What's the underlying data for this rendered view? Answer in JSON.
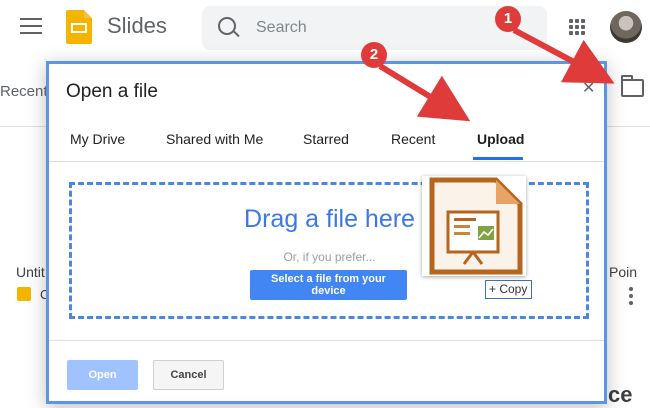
{
  "app": {
    "title": "Slides",
    "search_placeholder": "Search",
    "menu_icon": "hamburger-menu-icon",
    "apps_icon": "apps-grid-icon",
    "folder_icon": "folder-icon",
    "brand_color": "#f4b400"
  },
  "background": {
    "recent_label": "Recent",
    "untitled_label": "Untit",
    "doc_letter": "C",
    "right_title": "Poin",
    "bottom_text": "ce"
  },
  "dialog": {
    "title": "Open a file",
    "close_icon": "close-icon",
    "tabs": [
      {
        "label": "My Drive"
      },
      {
        "label": "Shared with Me"
      },
      {
        "label": "Starred"
      },
      {
        "label": "Recent"
      },
      {
        "label": "Upload",
        "active": true
      }
    ],
    "drop_title": "Drag a file here",
    "drop_subtitle": "Or, if you prefer...",
    "select_button": "Select a file from your device",
    "open_button": "Open",
    "cancel_button": "Cancel",
    "accent_color": "#4285f4"
  },
  "drag": {
    "file_icon": "impress-presentation-file-icon",
    "copy_label": "+ Copy"
  },
  "annotations": {
    "marker_1": "1",
    "marker_2": "2",
    "color": "#e03b3b"
  }
}
